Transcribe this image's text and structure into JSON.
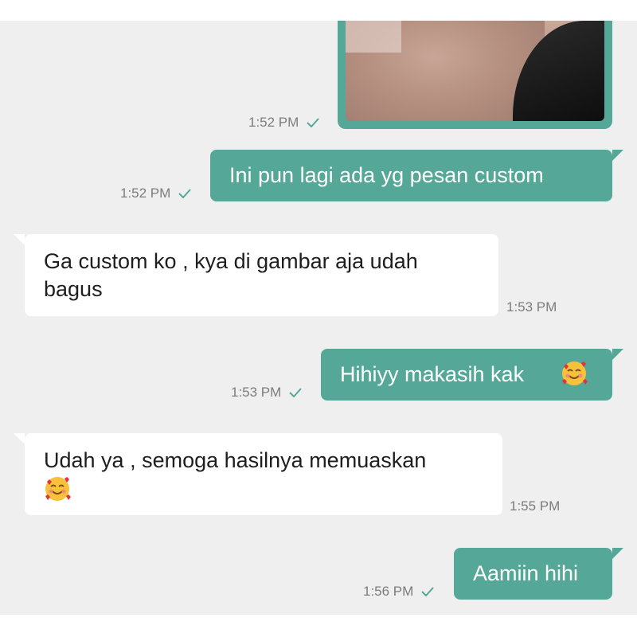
{
  "messages": [
    {
      "type": "image",
      "direction": "out",
      "time": "1:52 PM"
    },
    {
      "type": "text",
      "direction": "out",
      "text": "Ini pun lagi ada yg pesan custom",
      "time": "1:52 PM"
    },
    {
      "type": "text",
      "direction": "in",
      "line1": "Ga custom ko , kya di gambar aja udah",
      "line2": "bagus",
      "time": "1:53 PM"
    },
    {
      "type": "text",
      "direction": "out",
      "text": "Hihiyy makasih kak",
      "emoji": "smiling-face-with-hearts",
      "time": "1:53 PM"
    },
    {
      "type": "text",
      "direction": "in",
      "text": "Udah ya , semoga hasilnya memuaskan",
      "emoji": "smiling-face-with-hearts",
      "time": "1:55 PM"
    },
    {
      "type": "text",
      "direction": "out",
      "text": "Aamiin hihi",
      "time": "1:56 PM"
    }
  ],
  "colors": {
    "outgoing": "#55a898",
    "incoming": "#ffffff",
    "background": "#efefef",
    "timestamp": "#7c7c7c"
  }
}
